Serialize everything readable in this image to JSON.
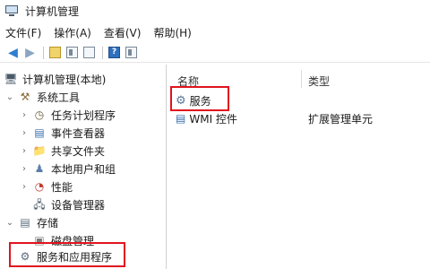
{
  "window": {
    "title": "计算机管理"
  },
  "menu": [
    "文件(F)",
    "操作(A)",
    "查看(V)",
    "帮助(H)"
  ],
  "toolbar": {
    "buttons": [
      "back-arrow",
      "forward-arrow",
      "up-folder",
      "show-hide-tree",
      "export",
      "help",
      "properties"
    ],
    "help_glyph": "?"
  },
  "tree": {
    "root": "计算机管理(本地)",
    "items": [
      {
        "label": "系统工具",
        "level": 1,
        "expander": "expanded"
      },
      {
        "label": "任务计划程序",
        "level": 2,
        "expander": "collapsed"
      },
      {
        "label": "事件查看器",
        "level": 2,
        "expander": "collapsed"
      },
      {
        "label": "共享文件夹",
        "level": 2,
        "expander": "collapsed"
      },
      {
        "label": "本地用户和组",
        "level": 2,
        "expander": "collapsed"
      },
      {
        "label": "性能",
        "level": 2,
        "expander": "collapsed"
      },
      {
        "label": "设备管理器",
        "level": 2,
        "expander": "none"
      },
      {
        "label": "存储",
        "level": 1,
        "expander": "expanded"
      },
      {
        "label": "磁盘管理",
        "level": 2,
        "expander": "none"
      },
      {
        "label": "服务和应用程序",
        "level": 1,
        "expander": "collapsed",
        "selected": true
      }
    ]
  },
  "list": {
    "columns": [
      "名称",
      "类型"
    ],
    "rows": [
      {
        "name": "服务",
        "type": ""
      },
      {
        "name": "WMI 控件",
        "type": "扩展管理单元"
      }
    ]
  },
  "colors": {
    "highlight": "#e0141e",
    "accent": "#2e7fd0"
  }
}
